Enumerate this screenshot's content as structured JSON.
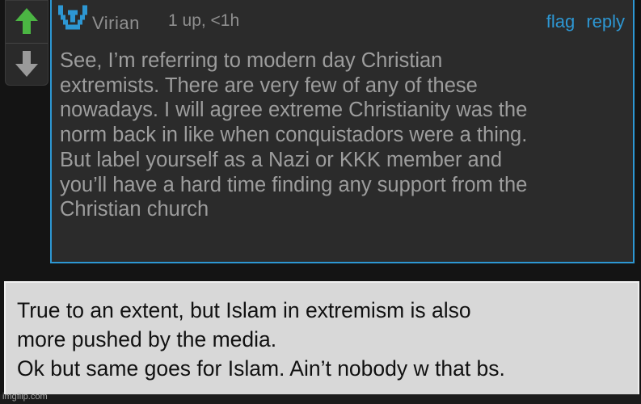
{
  "vote": {
    "up_icon": "arrow-up-icon",
    "down_icon": "arrow-down-icon",
    "up_color": "#4bb543",
    "down_color": "#9a9a9a"
  },
  "comment": {
    "avatar_icon": "pixel-avatar-icon",
    "avatar_color": "#2d97d3",
    "username": "Virian",
    "meta": "1 up, <1h",
    "flag_label": "flag",
    "reply_label": "reply",
    "accent_color": "#2d97d3",
    "lines": [
      "See, I’m referring to modern day Christian",
      "extremists. There are very few of any of these",
      "nowadays. I will agree extreme Christianity was the",
      "norm back in like when conquistadors were a thing.",
      "But label yourself as a Nazi or KKK member and",
      "you’ll have a hard time finding any support from the",
      "Christian church"
    ]
  },
  "caption": {
    "lines": [
      "True to an extent, but Islam in extremism is also",
      "more pushed by the media.",
      "Ok but same goes for Islam. Ain’t nobody w that bs."
    ]
  },
  "watermark": "imgflip.com"
}
